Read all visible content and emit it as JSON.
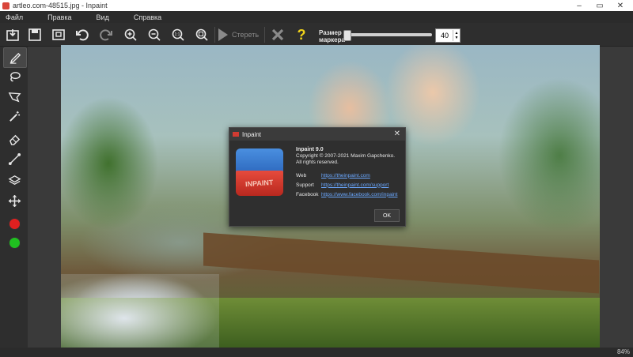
{
  "window": {
    "title": "artleo.com-48515.jpg - Inpaint"
  },
  "menu": [
    "Файл",
    "Правка",
    "Вид",
    "Справка"
  ],
  "toolbar": {
    "erase_label": "Стереть",
    "marker_size_label_line1": "Размер",
    "marker_size_label_line2": "маркера",
    "marker_size_value": "40",
    "marker_size_fraction": 0.0
  },
  "left_tools": {
    "color_red": "#e02020",
    "color_green": "#20c020"
  },
  "status": {
    "zoom": "84%"
  },
  "dialog": {
    "title": "Inpaint",
    "logo_text": "INPAINT",
    "app_name": "Inpaint 9.0",
    "copyright": "Copyright © 2007-2021 Maxim Gapchenko.",
    "rights": "All rights reserved.",
    "rows": [
      {
        "key": "Web",
        "value": "https://theinpaint.com"
      },
      {
        "key": "Support",
        "value": "https://theinpaint.com/support"
      },
      {
        "key": "Facebook",
        "value": "https://www.facebook.com/inpaint"
      }
    ],
    "ok_label": "OK"
  }
}
